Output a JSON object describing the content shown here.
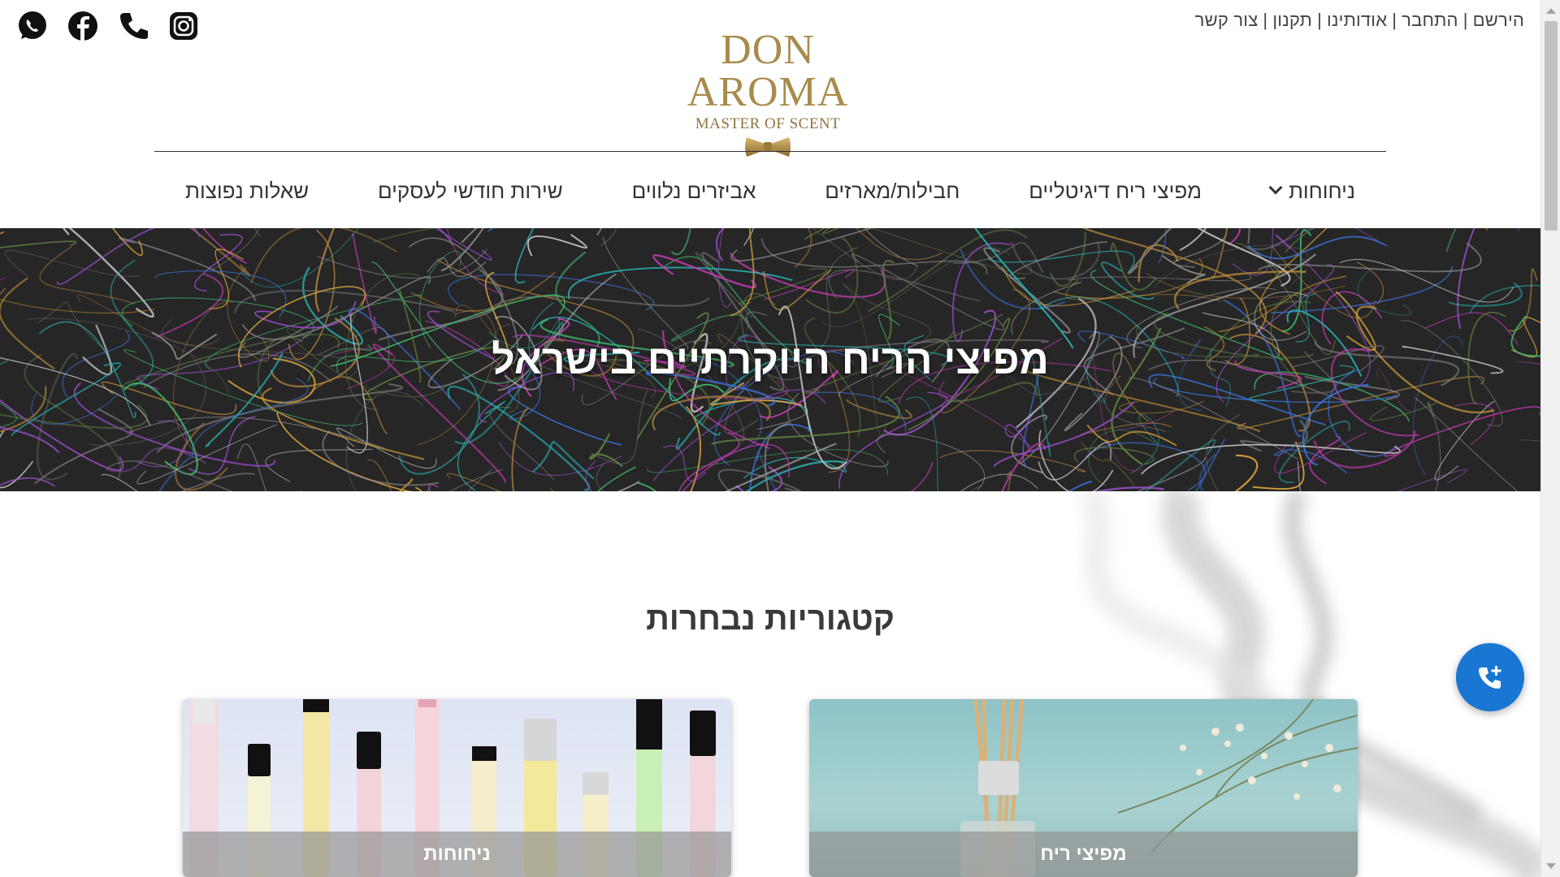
{
  "header": {
    "top_links": [
      "הירשם",
      "התחבר",
      "אודותינו",
      "תקנון",
      "צור קשר"
    ],
    "separator": "|",
    "social": [
      "whatsapp-icon",
      "facebook-icon",
      "phone-icon",
      "instagram-icon"
    ],
    "logo": {
      "name": "DON AROMA",
      "tagline": "MASTER OF SCENT"
    }
  },
  "nav": {
    "items": [
      "ניחוחות",
      "מפיצי ריח דיגיטליים",
      "חבילות/מארזים",
      "אביזרים נלווים",
      "שירות חודשי לעסקים",
      "שאלות נפוצות"
    ]
  },
  "hero": {
    "title": "מפיצי הריח היוקרתיים בישראל"
  },
  "categories": {
    "title": "קטגוריות נבחרות",
    "cards": [
      {
        "label": "מפיצי ריח"
      },
      {
        "label": "ניחוחות"
      }
    ]
  },
  "colors": {
    "accent": "#1976d2",
    "gold": "#a98b4c",
    "hero_bg": "#262626"
  }
}
